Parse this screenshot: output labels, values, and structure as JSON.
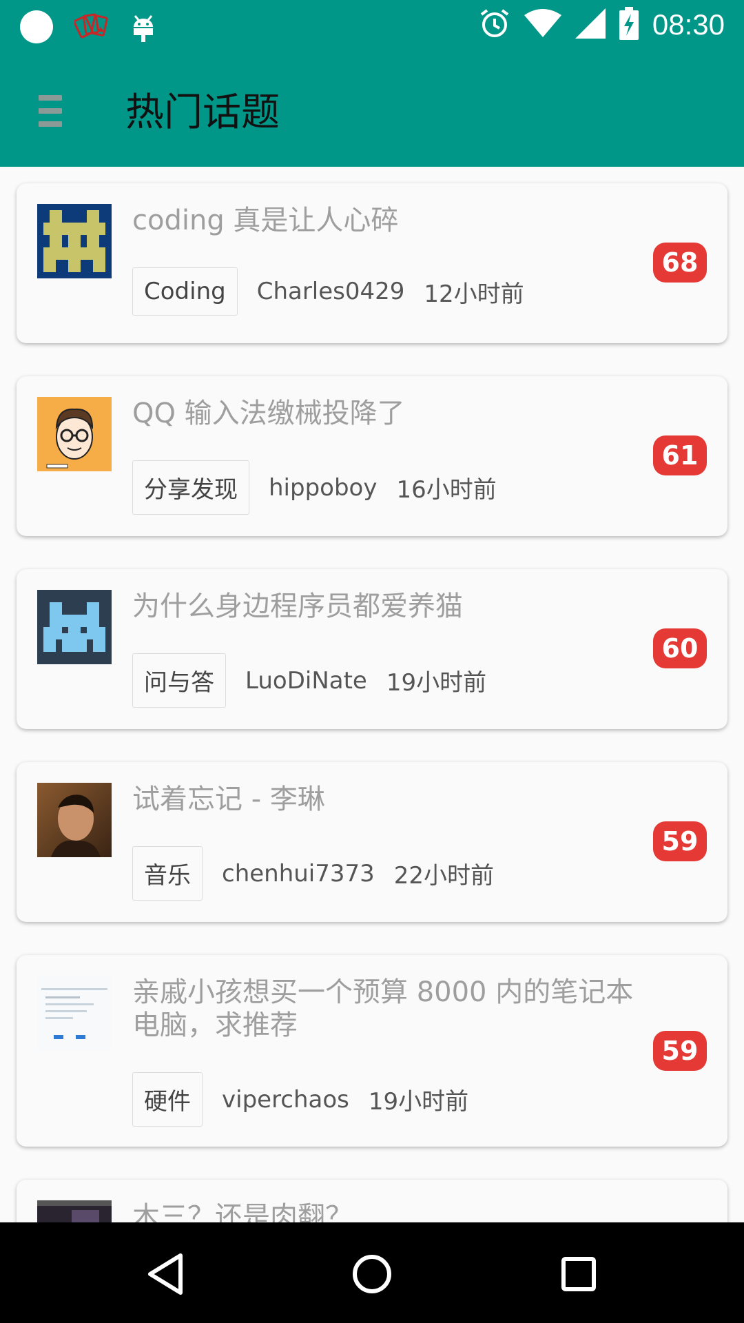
{
  "status_bar": {
    "time": "08:30",
    "icons": [
      "circle-icon",
      "cards-icon",
      "android-icon",
      "alarm-icon",
      "wifi-icon",
      "signal-icon",
      "battery-charging-icon"
    ]
  },
  "app_bar": {
    "title": "热门话题",
    "menu_icon": "menu-icon"
  },
  "topics": [
    {
      "title": "coding 真是让人心碎",
      "tag": "Coding",
      "author": "Charles0429",
      "time": "12小时前",
      "count": "68",
      "avatar": "pixel-invader-yellow"
    },
    {
      "title": "QQ 输入法缴械投降了",
      "tag": "分享发现",
      "author": "hippoboy",
      "time": "16小时前",
      "count": "61",
      "avatar": "cartoon-face"
    },
    {
      "title": "为什么身边程序员都爱养猫",
      "tag": "问与答",
      "author": "LuoDiNate",
      "time": "19小时前",
      "count": "60",
      "avatar": "pixel-invader-blue"
    },
    {
      "title": "试着忘记 - 李琳",
      "tag": "音乐",
      "author": "chenhui7373",
      "time": "22小时前",
      "count": "59",
      "avatar": "photo-portrait"
    },
    {
      "title": "亲戚小孩想买一个预算 8000 内的笔记本电脑，求推荐",
      "tag": "硬件",
      "author": "viperchaos",
      "time": "19小时前",
      "count": "59",
      "avatar": "screenshot-thumbnail"
    },
    {
      "title": "木三？还是肉翻？",
      "tag": "",
      "author": "",
      "time": "",
      "count": "",
      "avatar": "dark-photo"
    }
  ],
  "nav_bar": {
    "icons": [
      "back-icon",
      "home-icon",
      "recents-icon"
    ]
  },
  "colors": {
    "primary": "#009688",
    "badge": "#e53935"
  }
}
